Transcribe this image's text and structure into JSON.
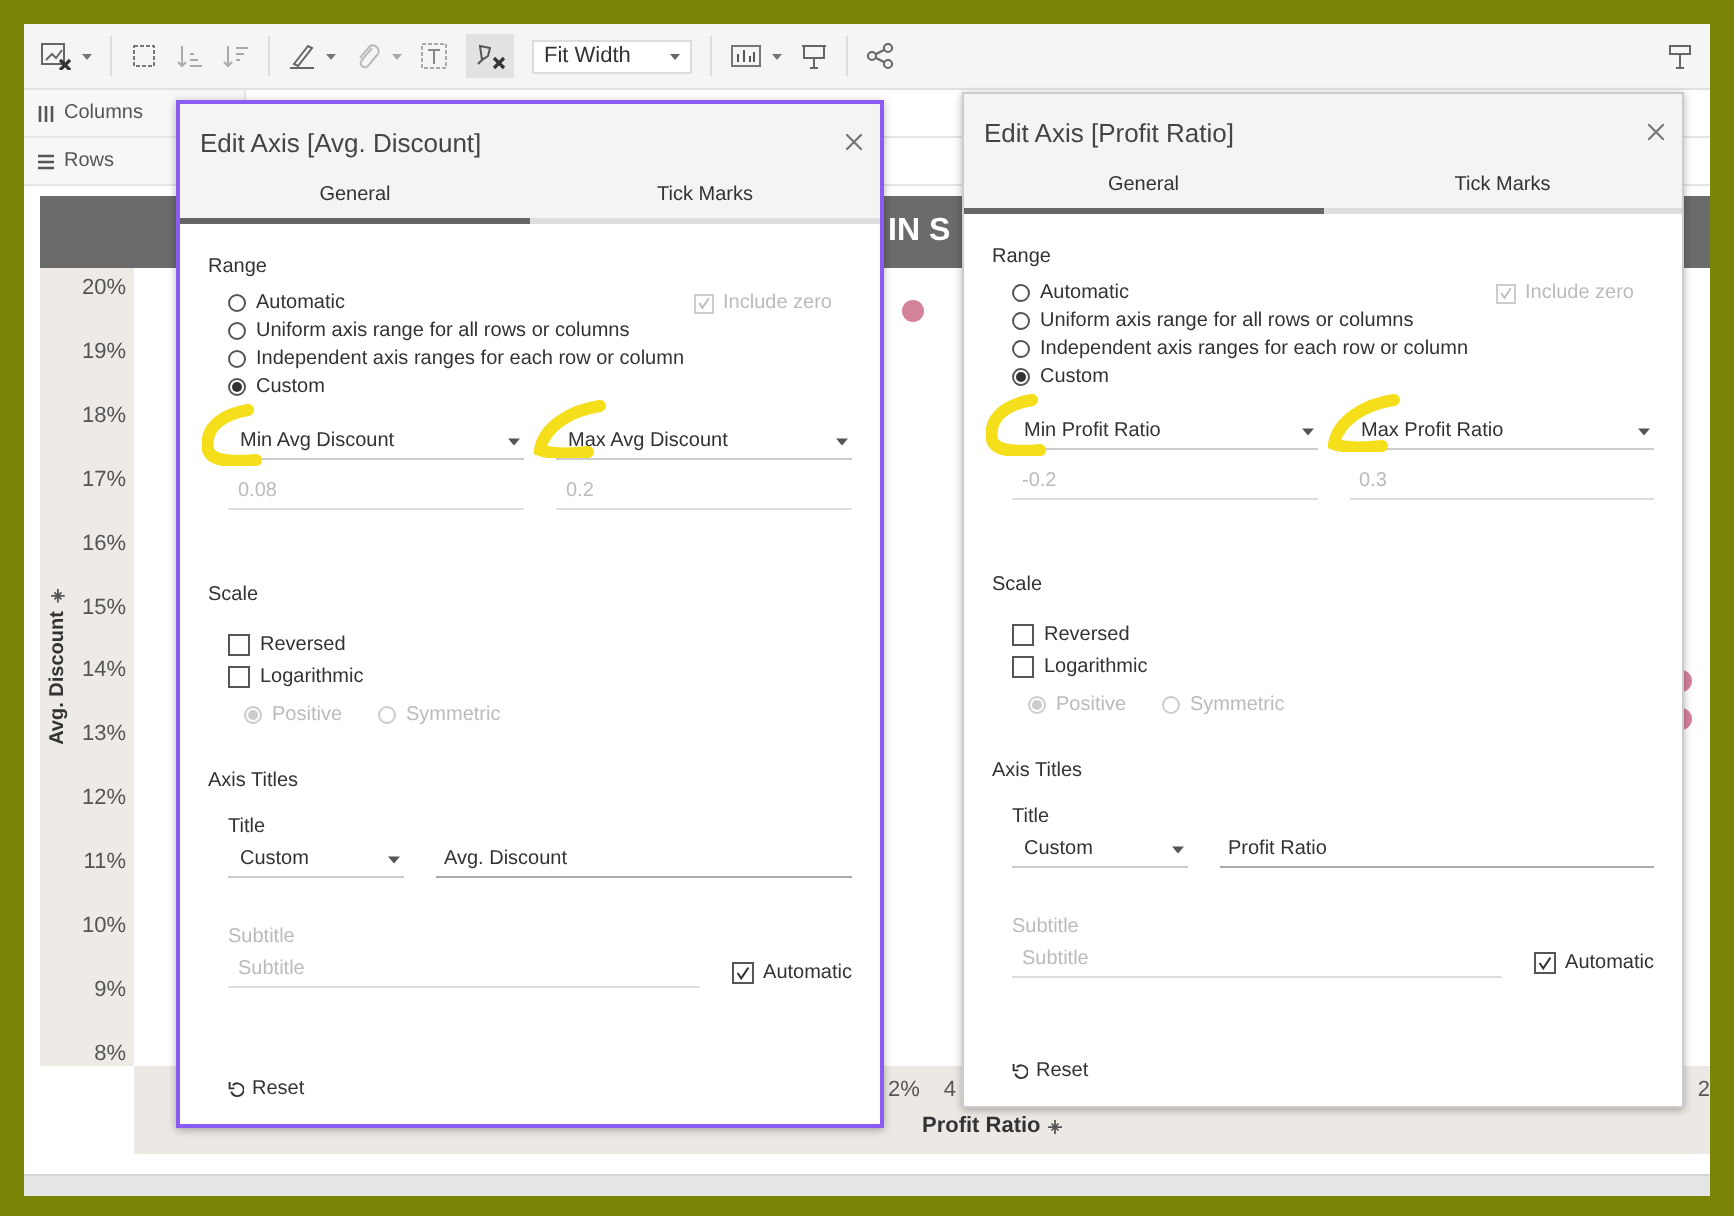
{
  "toolbar": {
    "fit_select": "Fit Width"
  },
  "shelves": [
    {
      "label": "Columns"
    },
    {
      "label": "Rows"
    }
  ],
  "view": {
    "title_fragment": "IN S",
    "y_axis": {
      "title": "Avg. Discount",
      "ticks": [
        "20%",
        "19%",
        "18%",
        "17%",
        "16%",
        "15%",
        "14%",
        "13%",
        "12%",
        "11%",
        "10%",
        "9%",
        "8%"
      ]
    },
    "x_axis": {
      "title": "Profit Ratio",
      "ticks": [
        "2%",
        "4",
        "2"
      ]
    }
  },
  "dialogs": [
    {
      "title": "Edit Axis [Avg. Discount]",
      "focused": true,
      "tabs": [
        {
          "label": "General",
          "selected": true
        },
        {
          "label": "Tick Marks",
          "selected": false
        }
      ],
      "range": {
        "heading": "Range",
        "options": [
          {
            "label": "Automatic",
            "selected": false
          },
          {
            "label": "Uniform axis range for all rows or columns",
            "selected": false
          },
          {
            "label": "Independent axis ranges for each row or column",
            "selected": false
          },
          {
            "label": "Custom",
            "selected": true
          }
        ],
        "include_zero": {
          "label": "Include zero",
          "checked": true,
          "disabled": true
        },
        "bounds": [
          {
            "select": "Min Avg Discount",
            "value": "0.08"
          },
          {
            "select": "Max Avg Discount",
            "value": "0.2"
          }
        ]
      },
      "scale": {
        "heading": "Scale",
        "options": [
          {
            "label": "Reversed",
            "checked": false
          },
          {
            "label": "Logarithmic",
            "checked": false
          }
        ],
        "sub_options": [
          {
            "label": "Positive",
            "selected": true,
            "disabled": true
          },
          {
            "label": "Symmetric",
            "selected": false,
            "disabled": true
          }
        ]
      },
      "axis_titles": {
        "heading": "Axis Titles",
        "title_label": "Title",
        "title_mode": "Custom",
        "title_value": "Avg. Discount",
        "subtitle_label": "Subtitle",
        "subtitle_placeholder": "Subtitle",
        "subtitle_disabled": true,
        "automatic": {
          "label": "Automatic",
          "checked": true
        }
      },
      "reset": "Reset"
    },
    {
      "title": "Edit Axis [Profit Ratio]",
      "focused": false,
      "tabs": [
        {
          "label": "General",
          "selected": true
        },
        {
          "label": "Tick Marks",
          "selected": false
        }
      ],
      "range": {
        "heading": "Range",
        "options": [
          {
            "label": "Automatic",
            "selected": false
          },
          {
            "label": "Uniform axis range for all rows or columns",
            "selected": false
          },
          {
            "label": "Independent axis ranges for each row or column",
            "selected": false
          },
          {
            "label": "Custom",
            "selected": true
          }
        ],
        "include_zero": {
          "label": "Include zero",
          "checked": true,
          "disabled": true
        },
        "bounds": [
          {
            "select": "Min Profit Ratio",
            "value": "-0.2"
          },
          {
            "select": "Max Profit Ratio",
            "value": "0.3"
          }
        ]
      },
      "scale": {
        "heading": "Scale",
        "options": [
          {
            "label": "Reversed",
            "checked": false
          },
          {
            "label": "Logarithmic",
            "checked": false
          }
        ],
        "sub_options": [
          {
            "label": "Positive",
            "selected": true,
            "disabled": true
          },
          {
            "label": "Symmetric",
            "selected": false,
            "disabled": true
          }
        ]
      },
      "axis_titles": {
        "heading": "Axis Titles",
        "title_label": "Title",
        "title_mode": "Custom",
        "title_value": "Profit Ratio",
        "subtitle_label": "Subtitle",
        "subtitle_placeholder": "Subtitle",
        "subtitle_disabled": true,
        "automatic": {
          "label": "Automatic",
          "checked": true
        }
      },
      "reset": "Reset"
    }
  ]
}
